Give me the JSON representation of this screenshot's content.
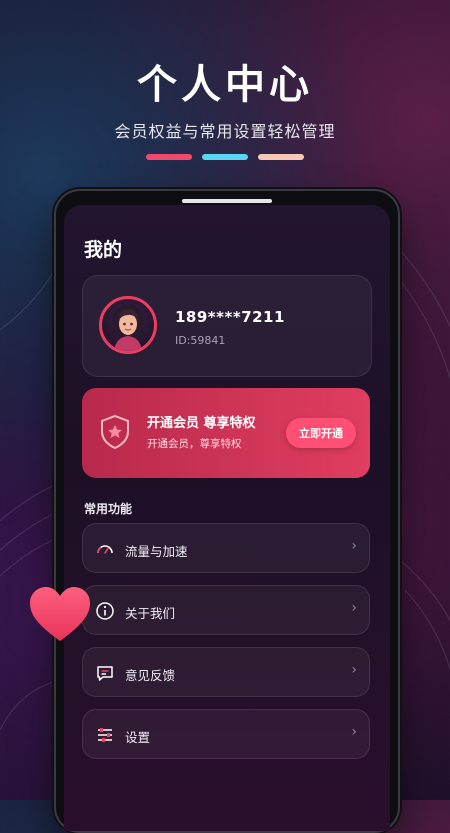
{
  "promo": {
    "title": "个人中心",
    "subtitle": "会员权益与常用设置轻松管理",
    "bar_colors": [
      "#ef4a6e",
      "#5ad6f4",
      "#f6c7b6"
    ]
  },
  "screen": {
    "title": "我的",
    "profile": {
      "phone": "189****7211",
      "id": "ID:59841",
      "avatar_icon": "woman-portrait-avatar"
    },
    "vip": {
      "title": "开通会员 尊享特权",
      "subtitle": "开通会员，尊享特权",
      "button": "立即开通",
      "icon": "shield-star-icon"
    },
    "section_title": "常用功能",
    "menu": [
      {
        "label": "流量与加速",
        "icon": "speedometer-icon"
      },
      {
        "label": "关于我们",
        "icon": "info-icon"
      },
      {
        "label": "意见反馈",
        "icon": "feedback-message-icon"
      },
      {
        "label": "设置",
        "icon": "sliders-settings-icon"
      }
    ],
    "chevron": "›"
  },
  "colors": {
    "accent": "#ee3d64",
    "vip_start": "#b8294b",
    "vip_end": "#e03e60",
    "background": "#1a1028"
  }
}
